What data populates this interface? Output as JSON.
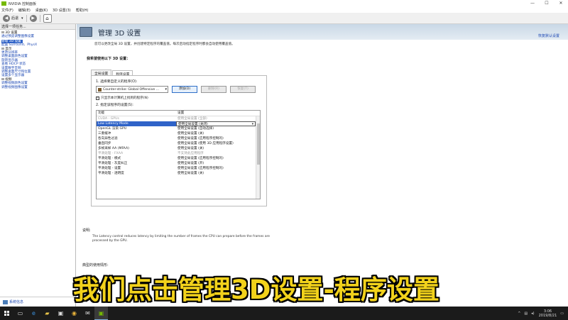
{
  "window": {
    "title": "NVIDIA 控制面板",
    "controls": [
      "—",
      "☐",
      "✕"
    ]
  },
  "menu": [
    "文件(F)",
    "编辑(E)",
    "桌面(K)",
    "3D 设置(3)",
    "帮助(H)"
  ],
  "toolbar": {
    "back": "后退",
    "forward": ""
  },
  "sidebar": {
    "header": "选择一项任务...",
    "tree": [
      {
        "text": "⊟ 3D 设置",
        "type": "cat"
      },
      {
        "text": "  通过预览调整图像设置",
        "type": "link"
      },
      {
        "text": "  管理 3D 设置",
        "type": "sel"
      },
      {
        "text": "  配置 Surround、PhysX",
        "type": "link"
      },
      {
        "text": "⊟ 显示",
        "type": "cat"
      },
      {
        "text": "  更改分辨率",
        "type": "link"
      },
      {
        "text": "  调整桌面颜色设置",
        "type": "link"
      },
      {
        "text": "  旋转显示器",
        "type": "link"
      },
      {
        "text": "  查看 HDCP 状态",
        "type": "link"
      },
      {
        "text": "  设置数字音频",
        "type": "link"
      },
      {
        "text": "  调整桌面尺寸和位置",
        "type": "link"
      },
      {
        "text": "  设置多个显示器",
        "type": "link"
      },
      {
        "text": "⊟ 视频",
        "type": "cat"
      },
      {
        "text": "  调整视频颜色设置",
        "type": "link"
      },
      {
        "text": "  调整视频图像设置",
        "type": "link"
      }
    ],
    "footer": "系统信息"
  },
  "main": {
    "title": "管理 3D 设置",
    "restore": "恢复默认设置",
    "description": "您可以更改全局 3D 设置，并创建特定程序的覆盖值。每次启动指定程序时都会自动使用覆盖值。",
    "group_title": "我希望使用以下 3D 设置：",
    "tabs": [
      "全局设置",
      "程序设置"
    ],
    "step1": "1. 选择要自定义的程序(O):",
    "program": "Counter-strike: Global Offensive ...",
    "buttons": [
      "添加(D)",
      "删除(R)",
      "恢复(T)"
    ],
    "checkbox": "只显示本计算机上找到的程序(N)",
    "step2": "2. 指定该程序的设置(S):",
    "columns": [
      "功能",
      "设置"
    ],
    "rows": [
      {
        "feature": "CUDA - GPUs",
        "setting": "使用全局设置 (全部)",
        "dim": true
      },
      {
        "feature": "Low Latency Mode",
        "setting": "使用全局设置 (关闭)",
        "sel": true
      },
      {
        "feature": "OpenGL 渲染 GPU",
        "setting": "使用全局设置 (自动选择)"
      },
      {
        "feature": "三重缓冲",
        "setting": "使用全局设置 (关)"
      },
      {
        "feature": "各向异性过滤",
        "setting": "使用全局设置 (应用程序控制的)"
      },
      {
        "feature": "垂直同步",
        "setting": "使用全局设置 (使用 3D 应用程序设置)"
      },
      {
        "feature": "多帧采样 AA (MFAA)",
        "setting": "使用全局设置 (关)"
      },
      {
        "feature": "平滑处理 - FXAA",
        "setting": "不支持此应用程序",
        "dim": true
      },
      {
        "feature": "平滑处理 - 模式",
        "setting": "使用全局设置 (应用程序控制的)"
      },
      {
        "feature": "平滑处理 - 灰度纠正",
        "setting": "使用全局设置 (开)"
      },
      {
        "feature": "平滑处理 - 设置",
        "setting": "使用全局设置 (应用程序控制的)"
      },
      {
        "feature": "平滑处理 - 透明度",
        "setting": "使用全局设置 (关)"
      }
    ],
    "desc_label": "说明:",
    "desc_text": "The Latency control reduces latency by limiting the number of frames the CPU can prepare before the frames are processed by the GPU.",
    "usage_label": "典型的使用情形:"
  },
  "subtitle": "我们点击管理3D设置-程序设置",
  "taskbar": {
    "time": "3:06",
    "date": "2019/8/21"
  }
}
